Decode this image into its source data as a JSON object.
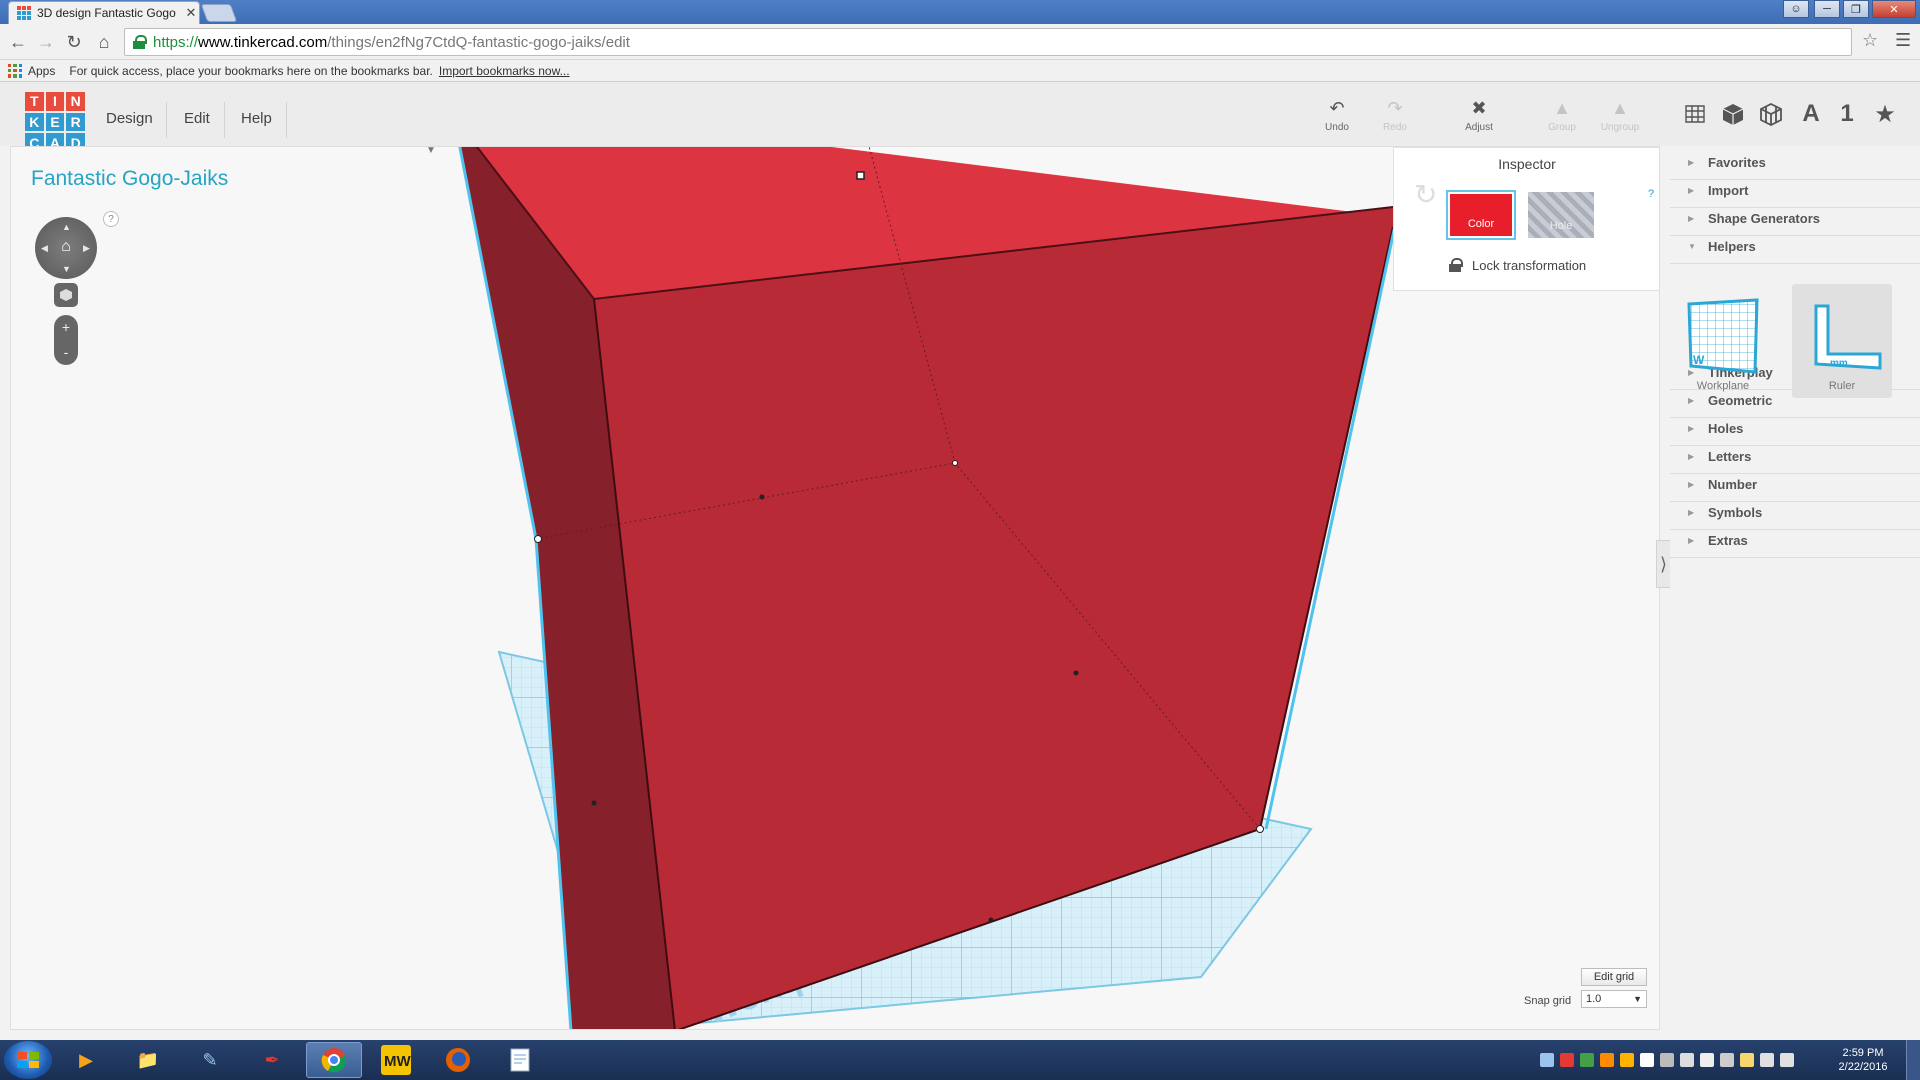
{
  "browser": {
    "tab_title": "3D design Fantastic Gogo",
    "tab_close": "✕",
    "url_scheme": "https://",
    "url_host": "www.tinkercad.com",
    "url_path": "/things/en2fNg7CtdQ-fantastic-gogo-jaiks/edit",
    "bookmarks": {
      "apps_label": "Apps",
      "hint": "For quick access, place your bookmarks here on the bookmarks bar.",
      "import_link": "Import bookmarks now..."
    }
  },
  "app": {
    "logo_letters": [
      "T",
      "I",
      "N",
      "K",
      "E",
      "R",
      "C",
      "A",
      "D"
    ],
    "logo_colors": [
      "#e74c3c",
      "#e74c3c",
      "#e74c3c",
      "#2f9bd0",
      "#2f9bd0",
      "#2f9bd0",
      "#2f9bd0",
      "#2f9bd0",
      "#2f9bd0"
    ],
    "menu": {
      "design": "Design",
      "edit": "Edit",
      "help": "Help"
    },
    "tools": {
      "undo": "Undo",
      "redo": "Redo",
      "adjust": "Adjust",
      "group": "Group",
      "ungroup": "Ungroup"
    },
    "view_tools": {
      "text": "A",
      "number": "1",
      "star": "★"
    }
  },
  "workspace": {
    "design_title": "Fantastic Gogo-Jaiks",
    "help_mark": "?",
    "zoom_in": "+",
    "zoom_out": "-",
    "workplane_text": "Workplane",
    "inspector": {
      "title": "Inspector",
      "help": "?",
      "color_label": "Color",
      "hole_label": "Hole",
      "lock_label": "Lock transformation",
      "shape_color": "#e81f2a"
    },
    "edit_grid": "Edit grid",
    "snap_grid_label": "Snap grid",
    "snap_grid_value": "1.0"
  },
  "sidebar": {
    "categories": [
      {
        "label": "Favorites",
        "expanded": false
      },
      {
        "label": "Import",
        "expanded": false
      },
      {
        "label": "Shape Generators",
        "expanded": false
      },
      {
        "label": "Helpers",
        "expanded": true
      },
      {
        "label": "Tinkerplay",
        "expanded": false
      },
      {
        "label": "Geometric",
        "expanded": false
      },
      {
        "label": "Holes",
        "expanded": false
      },
      {
        "label": "Letters",
        "expanded": false
      },
      {
        "label": "Number",
        "expanded": false
      },
      {
        "label": "Symbols",
        "expanded": false
      },
      {
        "label": "Extras",
        "expanded": false
      }
    ],
    "helpers": [
      {
        "label": "Workplane",
        "badge": "W"
      },
      {
        "label": "Ruler",
        "badge": "mm"
      }
    ]
  },
  "taskbar": {
    "time": "2:59 PM",
    "date": "2/22/2016"
  }
}
